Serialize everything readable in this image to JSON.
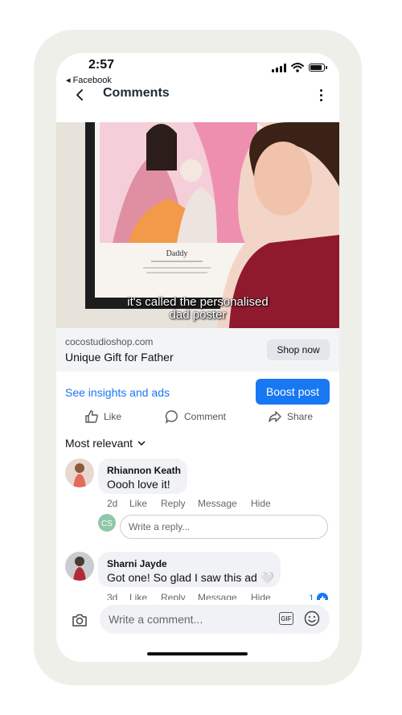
{
  "status": {
    "time": "2:57",
    "back_app": "◂ Facebook"
  },
  "header": {
    "title": "Comments"
  },
  "video": {
    "caption_line1": "it's called the personalised",
    "caption_line2": "dad poster",
    "poster_title": "Daddy"
  },
  "link": {
    "domain": "cocostudioshop.com",
    "headline": "Unique Gift for Father",
    "cta": "Shop now"
  },
  "promo": {
    "insights": "See insights and ads",
    "boost": "Boost post"
  },
  "actions": {
    "like": "Like",
    "comment": "Comment",
    "share": "Share"
  },
  "sort": {
    "label": "Most relevant"
  },
  "comments": [
    {
      "name": "Rhiannon Keath",
      "text": "Oooh love it!",
      "age": "2d",
      "like": "Like",
      "reply": "Reply",
      "message": "Message",
      "hide": "Hide"
    },
    {
      "name": "Sharni Jayde",
      "text": "Got one! So glad I saw this ad 🤍",
      "age": "3d",
      "like": "Like",
      "reply": "Reply",
      "message": "Message",
      "hide": "Hide",
      "reactions": "1"
    }
  ],
  "reply_box": {
    "placeholder": "Write a reply..."
  },
  "composer": {
    "placeholder": "Write a comment...",
    "gif": "GIF"
  },
  "colors": {
    "accent": "#1877f2",
    "frame": "#efefea"
  }
}
